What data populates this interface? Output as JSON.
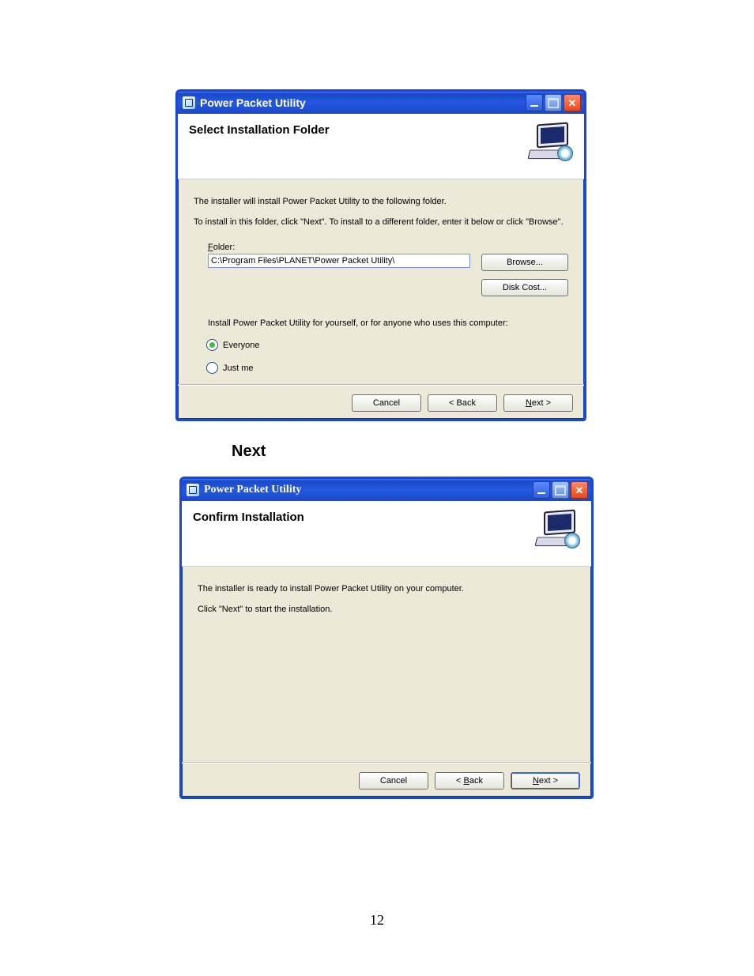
{
  "page_number": "12",
  "between_label": "Next",
  "window1": {
    "title": "Power Packet Utility",
    "heading": "Select Installation Folder",
    "line1": "The installer will install Power Packet Utility  to the following folder.",
    "line2": "To install in this folder, click \"Next\". To install to a different folder, enter it below or click \"Browse\".",
    "folder_label": "Folder:",
    "folder_value": "C:\\Program Files\\PLANET\\Power Packet Utility\\",
    "browse_label": "Browse...",
    "diskcost_label": "Disk Cost...",
    "install_for_label": "Install Power Packet Utility  for yourself, or for anyone who uses this computer:",
    "radio_everyone": "Everyone",
    "radio_justme": "Just me",
    "cancel_label": "Cancel",
    "back_label": "< Back",
    "next_label": "Next >"
  },
  "window2": {
    "title": "Power Packet Utility",
    "heading": "Confirm Installation",
    "line1": "The installer is ready to install Power Packet Utility  on your computer.",
    "line2": "Click \"Next\" to start the installation.",
    "cancel_label": "Cancel",
    "back_label": "< Back",
    "next_label": "Next >"
  }
}
